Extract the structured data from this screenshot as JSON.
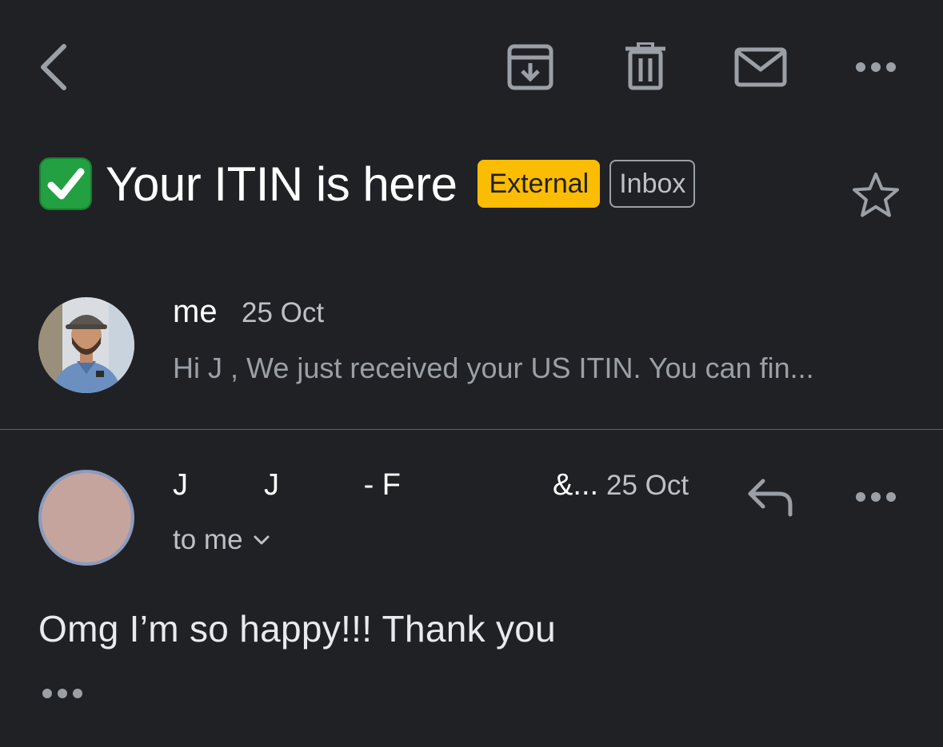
{
  "toolbar": {
    "back_icon": "chevron-left-icon",
    "archive_icon": "archive-icon",
    "delete_icon": "trash-icon",
    "mark_unread_icon": "mail-icon",
    "more_icon": "more-horizontal-icon"
  },
  "subject": {
    "emoji": "✅",
    "text": "Your ITIN is here",
    "labels": [
      {
        "text": "External",
        "color": "#fbbc04"
      },
      {
        "text": "Inbox"
      }
    ],
    "star_icon": "star-outline-icon"
  },
  "thread": [
    {
      "sender": "me",
      "date": "25 Oct",
      "snippet": "Hi J      , We just received your US ITIN. You can fin..."
    },
    {
      "sender": "J         J          - F                  &...",
      "date": "25 Oct",
      "recipient": "to me",
      "body": "Omg I’m so happy!!! Thank you",
      "reply_icon": "reply-icon",
      "more_icon": "more-horizontal-icon",
      "show_trimmed_icon": "more-horizontal-icon"
    }
  ],
  "colors": {
    "background": "#202124",
    "external_label": "#fbbc04",
    "avatar_placeholder": "#c6a49e"
  }
}
